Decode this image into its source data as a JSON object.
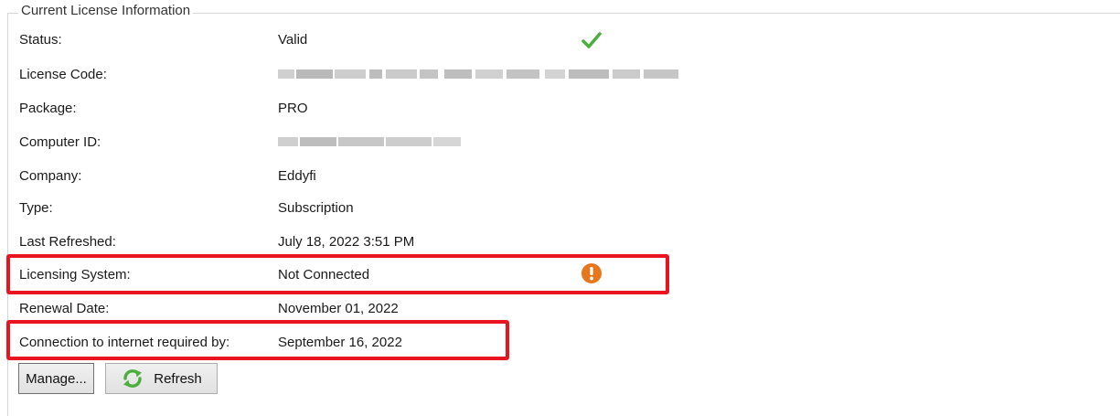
{
  "group": {
    "title": "Current License Information"
  },
  "rows": [
    {
      "label": "Status:",
      "value": "Valid",
      "icon": "checkmark-icon"
    },
    {
      "label": "License Code:",
      "value": ""
    },
    {
      "label": "Package:",
      "value": "PRO"
    },
    {
      "label": "Computer ID:",
      "value": ""
    },
    {
      "label": "Company:",
      "value": "Eddyfi"
    },
    {
      "label": "Type:",
      "value": "Subscription"
    },
    {
      "label": "Last Refreshed:",
      "value": "July 18, 2022 3:51 PM"
    },
    {
      "label": "Licensing System:",
      "value": "Not Connected",
      "icon": "warning-icon"
    },
    {
      "label": "Renewal Date:",
      "value": "November 01, 2022"
    },
    {
      "label": "Connection to internet required by:",
      "value": "September 16, 2022"
    }
  ],
  "buttons": {
    "manage": "Manage...",
    "refresh": "Refresh"
  },
  "colors": {
    "check": "#4caf3d",
    "warning": "#e8761c",
    "highlight": "#e8141f"
  }
}
